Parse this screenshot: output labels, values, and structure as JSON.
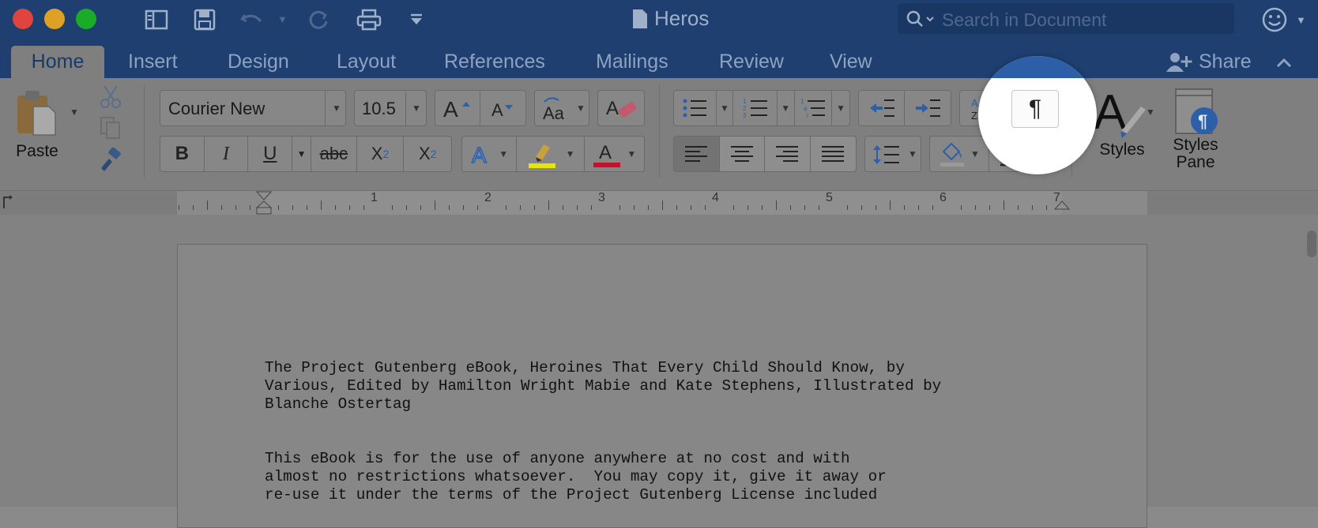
{
  "window": {
    "title": "Heros"
  },
  "search": {
    "placeholder": "Search in Document"
  },
  "tabs": [
    "Home",
    "Insert",
    "Design",
    "Layout",
    "References",
    "Mailings",
    "Review",
    "View"
  ],
  "share_label": "Share",
  "clipboard": {
    "paste_label": "Paste"
  },
  "font": {
    "name": "Courier New",
    "size": "10.5"
  },
  "format": {
    "bold": "B",
    "italic": "I",
    "underline": "U",
    "strikethrough": "abc",
    "subscript": "X",
    "subscript_mark": "2",
    "superscript": "X",
    "superscript_mark": "2"
  },
  "styles": {
    "styles_label": "Styles",
    "pane_label_1": "Styles",
    "pane_label_2": "Pane"
  },
  "pilcrow": "¶",
  "ruler": {
    "numbers": [
      "1",
      "2",
      "3",
      "4",
      "5",
      "6",
      "7"
    ]
  },
  "document": {
    "lines": [
      "The Project Gutenberg eBook, Heroines That Every Child Should Know, by",
      "Various, Edited by Hamilton Wright Mabie and Kate Stephens, Illustrated by",
      "Blanche Ostertag",
      "",
      "",
      "This eBook is for the use of anyone anywhere at no cost and with",
      "almost no restrictions whatsoever.  You may copy it, give it away or",
      "re-use it under the terms of the Project Gutenberg License included"
    ]
  },
  "colors": {
    "titlebar": "#1e3f70",
    "highlight": "#e6e600",
    "font_color": "#c8102e",
    "accent": "#2d5fa8"
  }
}
